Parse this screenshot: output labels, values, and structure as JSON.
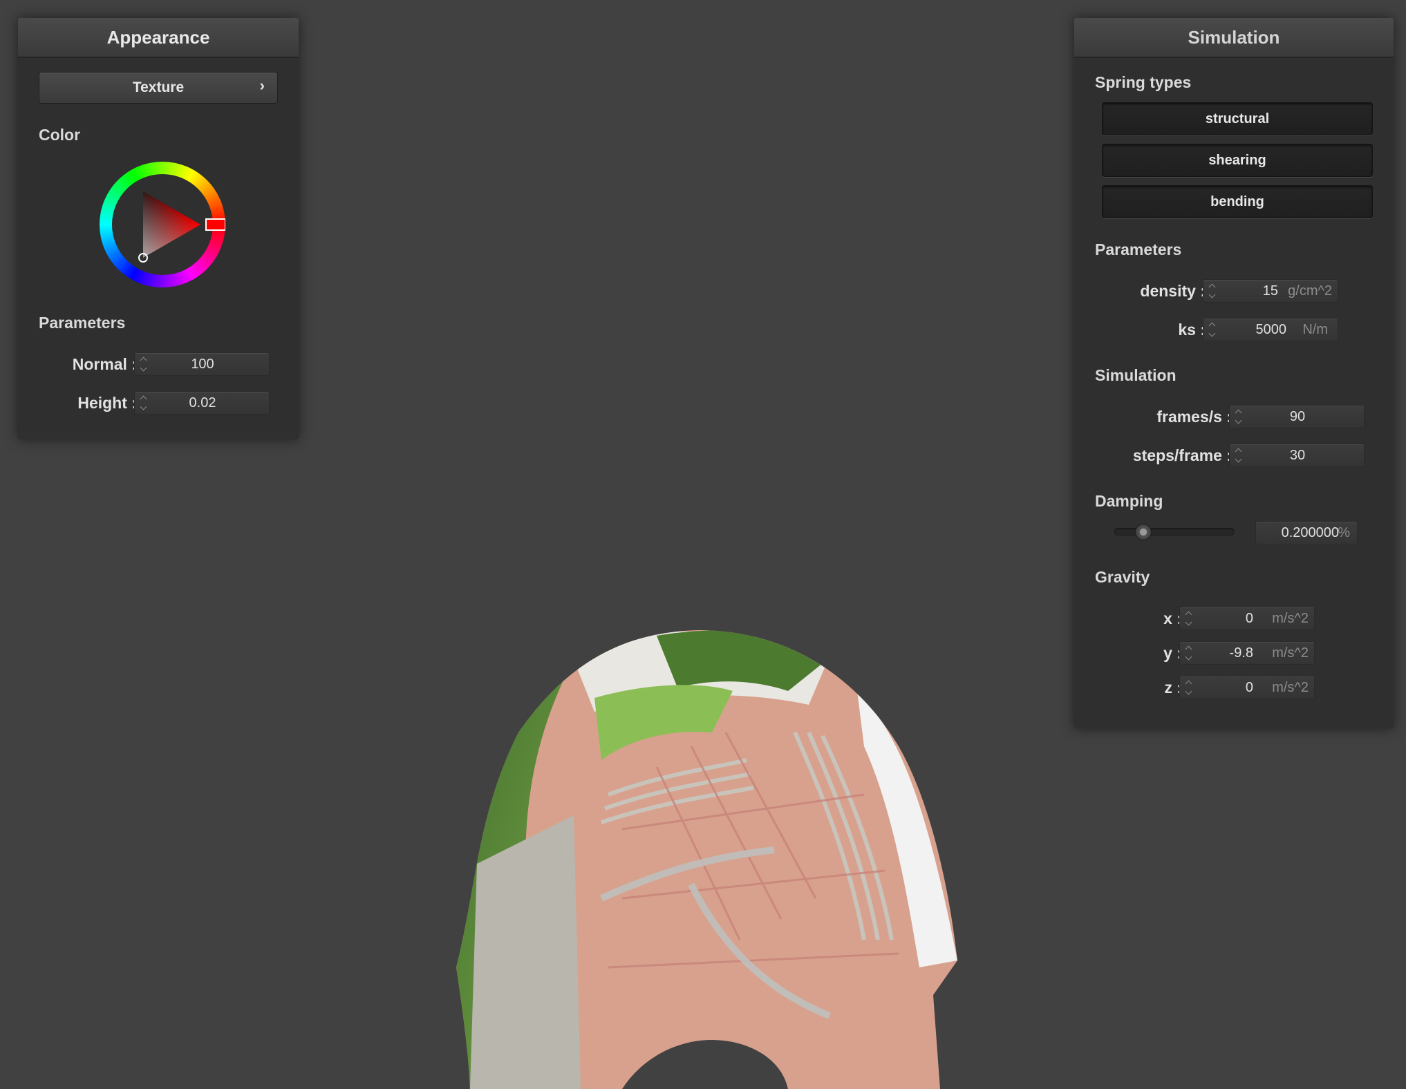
{
  "appearance": {
    "title": "Appearance",
    "texture_button": "Texture",
    "texture_chevron": "›",
    "color_label": "Color",
    "parameters_label": "Parameters",
    "normal_label": "Normal :",
    "normal_value": "100",
    "height_label": "Height :",
    "height_value": "0.02",
    "selected_color": "#ff0000"
  },
  "simulation": {
    "title": "Simulation",
    "spring_types_label": "Spring types",
    "spring_types": [
      "structural",
      "shearing",
      "bending"
    ],
    "parameters_label": "Parameters",
    "density_label": "density :",
    "density_value": "15",
    "density_unit": "g/cm^2",
    "ks_label": "ks :",
    "ks_value": "5000",
    "ks_unit": "N/m",
    "simulation_label": "Simulation",
    "fps_label": "frames/s :",
    "fps_value": "90",
    "steps_label": "steps/frame :",
    "steps_value": "30",
    "damping_label": "Damping",
    "damping_value": "0.200000",
    "damping_unit": "%",
    "damping_level": 0.2,
    "gravity_label": "Gravity",
    "gx_label": "x :",
    "gx_value": "0",
    "gy_label": "y :",
    "gy_value": "-9.8",
    "gz_label": "z :",
    "gz_value": "0",
    "gravity_unit": "m/s^2"
  },
  "colors": {
    "background": "#414141",
    "panel": "#2f2f2f",
    "cloth_brick": "#d9a592",
    "cloth_grass": "#6a9a3a"
  }
}
